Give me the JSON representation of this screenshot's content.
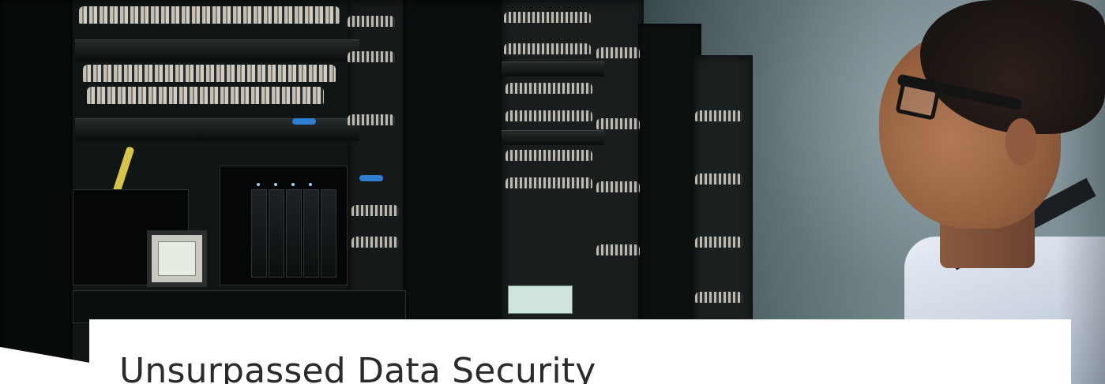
{
  "hero": {
    "image_alt": "Technician looking at server racks with network cabling",
    "caption": {
      "title": "Unsurpassed Data Security"
    }
  },
  "colors": {
    "card_background": "#ffffff",
    "title_text": "#2b2b2b"
  }
}
